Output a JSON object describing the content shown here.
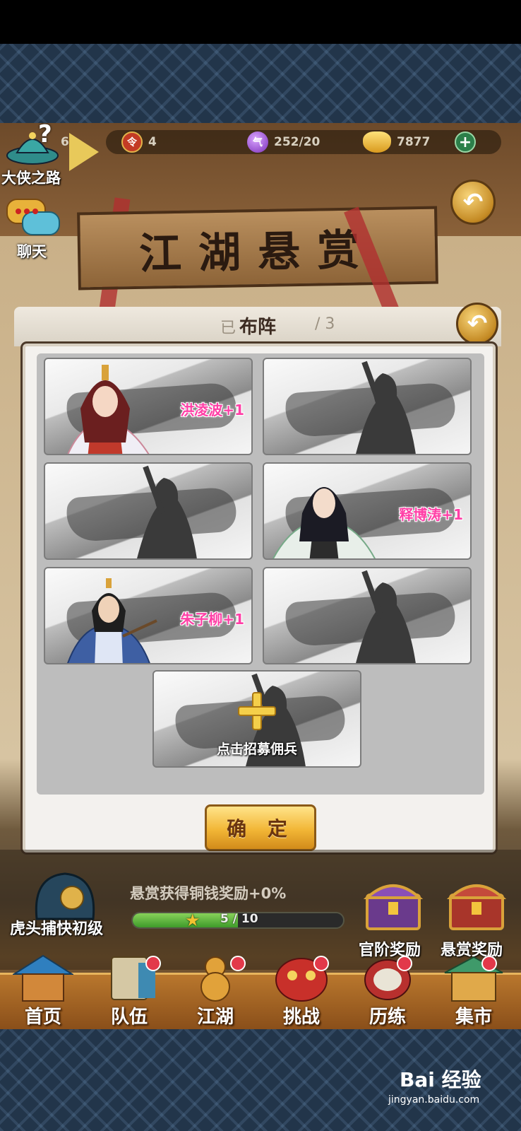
{
  "resources": {
    "level": "6",
    "tokens": "4",
    "energy": "252/20",
    "gold": "7877"
  },
  "left_menu": {
    "hero_road": "大侠之路",
    "chat": "聊天"
  },
  "banner": {
    "title": "江湖悬赏"
  },
  "dialog": {
    "title": "布阵",
    "behind_left": "已",
    "behind_right": "/ 3",
    "cards": [
      {
        "name": "洪凌波+1",
        "filled": true
      },
      {
        "name": "",
        "filled": false
      },
      {
        "name": "",
        "filled": false
      },
      {
        "name": "释博涛+1",
        "filled": true
      },
      {
        "name": "朱子柳+1",
        "filled": true
      },
      {
        "name": "",
        "filled": false
      }
    ],
    "recruit_label": "点击招募佣兵",
    "confirm_label": "确 定"
  },
  "bounty": {
    "rank": "虎头捕快初级",
    "bonus_text": "悬赏获得铜钱奖励+0%",
    "progress_text": "5 / 10",
    "progress": 0.5,
    "official_reward": "官阶奖励",
    "bounty_reward": "悬赏奖励"
  },
  "nav": [
    {
      "label": "首页",
      "icon": "home-icon"
    },
    {
      "label": "队伍",
      "icon": "team-icon"
    },
    {
      "label": "江湖",
      "icon": "gourd-icon"
    },
    {
      "label": "挑战",
      "icon": "lion-mask-icon"
    },
    {
      "label": "历练",
      "icon": "drum-icon"
    },
    {
      "label": "集市",
      "icon": "market-icon"
    }
  ],
  "watermark": {
    "brand": "Bai 经验",
    "url": "jingyan.baidu.com"
  }
}
